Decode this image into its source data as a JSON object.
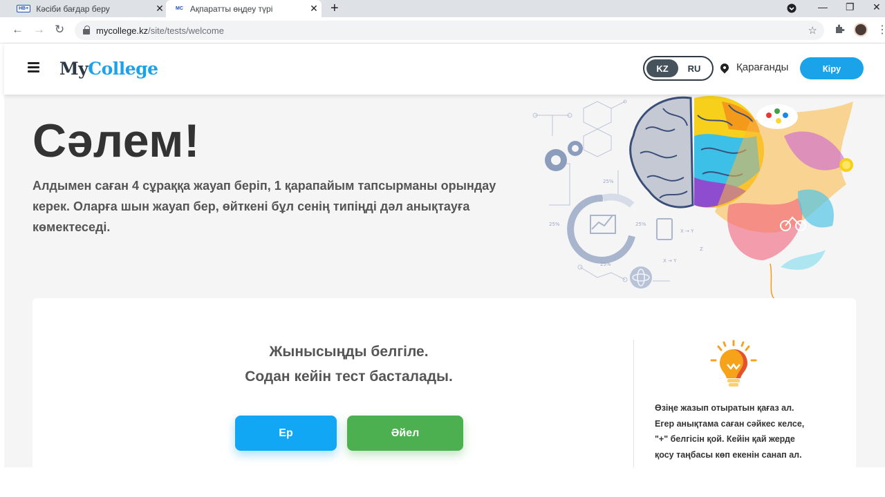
{
  "browser": {
    "tabs": [
      {
        "favicon": "НВ+",
        "title": "Кәсіби бағдар беру",
        "active": false
      },
      {
        "favicon": "MC",
        "title": "Ақпаратты өңдеу түрі",
        "active": true
      }
    ],
    "url_host": "mycollege.kz",
    "url_path": "/site/tests/welcome"
  },
  "header": {
    "logo_my": "My",
    "logo_college": "College",
    "lang": {
      "kz": "KZ",
      "ru": "RU",
      "active": "KZ"
    },
    "city": "Қарағанды",
    "login_label": "Кіру"
  },
  "hero": {
    "title": "Сәлем!",
    "text": "Алдымен саған 4 сұраққа жауап беріп, 1 қарапайым тапсырманы орындау керек. Оларға шын жауап бер, өйткені бұл сенің типіңді дәл анықтауға көмектеседі."
  },
  "card": {
    "prompt_line1": "Жынысыңды белгіле.",
    "prompt_line2": "Содан кейін тест басталады.",
    "male_label": "Ер",
    "female_label": "Әйел",
    "hint_lines": [
      "Өзіңе жазып отыратын қағаз ал.",
      "Егер анықтама саған сәйкес келсе,",
      "\"+\" белгісін қой. Кейін қай жерде",
      "қосу таңбасы көп екенін санап ал."
    ]
  },
  "illustration": {
    "labels": [
      "25%",
      "25%",
      "25%",
      "25%",
      "X → Y",
      "X → Y",
      "Z"
    ]
  },
  "colors": {
    "brand_blue": "#1aa3e8",
    "female_green": "#4caf50",
    "text_dark": "#333333"
  }
}
